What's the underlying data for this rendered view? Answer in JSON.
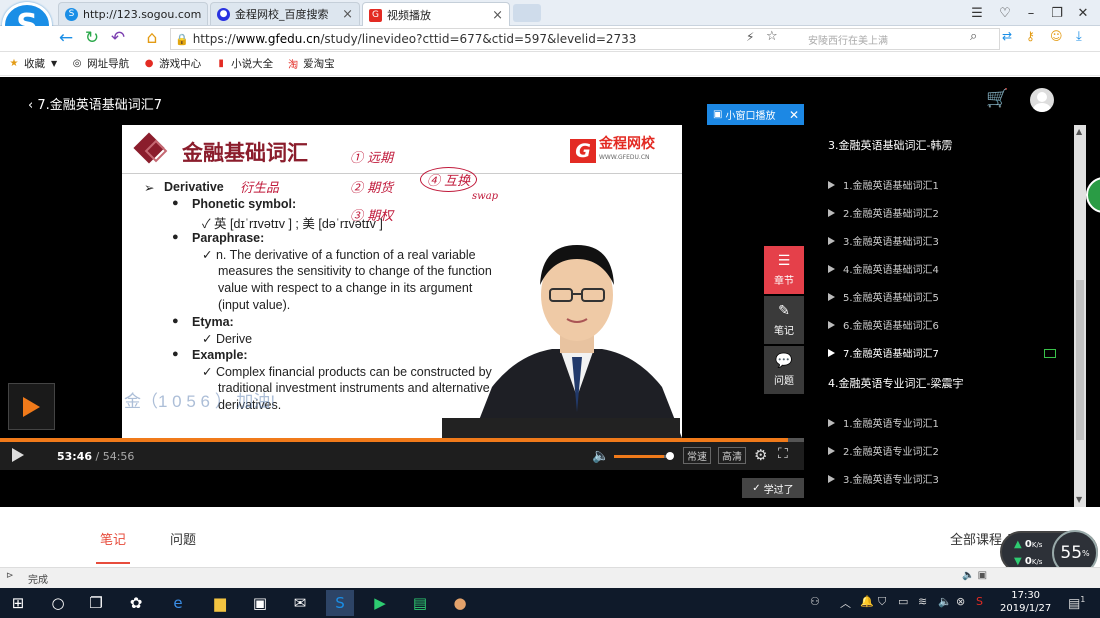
{
  "browser": {
    "tabs": [
      {
        "label": "http://123.sogou.com",
        "icon": "sogou-icon"
      },
      {
        "label": "金程网校_百度搜索",
        "icon": "baidu-paw-icon"
      },
      {
        "label": "视频播放",
        "icon": "gfedu-icon"
      }
    ],
    "url_prefix": "https://",
    "url_domain": "www.gfedu.cn",
    "url_path": "/study/linevideo?cttid=677&ctid=597&levelid=2733",
    "search_hint": "安陵西行在美上满",
    "bookmarks": [
      {
        "label": "收藏",
        "icon": "star-icon"
      },
      {
        "label": "网址导航",
        "icon": "globe-icon"
      },
      {
        "label": "游戏中心",
        "icon": "game-icon"
      },
      {
        "label": "小说大全",
        "icon": "book-icon"
      },
      {
        "label": "爱淘宝",
        "icon": "taobao-icon"
      }
    ],
    "status": "完成"
  },
  "player": {
    "back_title": "7.金融英语基础词汇7",
    "mini_play": "小窗口播放",
    "current_time": "53:46",
    "total_time": "54:56",
    "progress": 0.98,
    "volume": 0.9,
    "speed_label": "常速",
    "quality_label": "高清",
    "learned_label": "学过了",
    "side_buttons": [
      {
        "label": "章节",
        "icon": "menu-icon"
      },
      {
        "label": "笔记",
        "icon": "pencil-icon"
      },
      {
        "label": "问题",
        "icon": "chat-icon"
      }
    ],
    "accent": "#f07a1a"
  },
  "slide": {
    "title": "金融基础词汇",
    "brand": "金程网校",
    "brand_url": "WWW.GFEDU.CN",
    "term": "Derivative",
    "handwriting": [
      "衍生品",
      "① 远期",
      "② 期货",
      "③ 期权",
      "④ 互换",
      "swap"
    ],
    "phonetic_label": "Phonetic symbol:",
    "phonetic": "✓ 英 [dɪˈrɪvətɪv ] ; 美 [dəˈrɪvətɪv ]",
    "paraphrase_label": "Paraphrase:",
    "paraphrase": [
      "✓ n. The derivative of a function of a real variable",
      "measures the sensitivity to change of the function",
      "value with respect to a change in its argument",
      "(input value)."
    ],
    "etyma_label": "Etyma:",
    "etyma": "✓ Derive",
    "example_label": "Example:",
    "example": [
      "✓ Complex financial products can be constructed by",
      "traditional investment instruments and alternative",
      "derivatives."
    ],
    "overlay": "金（1     0 5 6 ）  加油!"
  },
  "playlist": {
    "sections": [
      {
        "title": "3.金融英语基础词汇-韩雳",
        "items": [
          "1.金融英语基础词汇1",
          "2.金融英语基础词汇2",
          "3.金融英语基础词汇3",
          "4.金融英语基础词汇4",
          "5.金融英语基础词汇5",
          "6.金融英语基础词汇6",
          "7.金融英语基础词汇7"
        ]
      },
      {
        "title": "4.金融英语专业词汇-梁震宇",
        "items": [
          "1.金融英语专业词汇1",
          "2.金融英语专业词汇2",
          "3.金融英语专业词汇3"
        ]
      }
    ],
    "current_index": 6
  },
  "below": {
    "tabs": [
      "笔记",
      "问题"
    ],
    "all_courses": "全部课程 ❯"
  },
  "netspeed": {
    "up": "0",
    "down": "0",
    "unit": "K/s",
    "percent": "55",
    "percent_sign": "%"
  },
  "taskbar": {
    "time": "17:30",
    "date": "2019/1/27",
    "notify_count": "1"
  }
}
